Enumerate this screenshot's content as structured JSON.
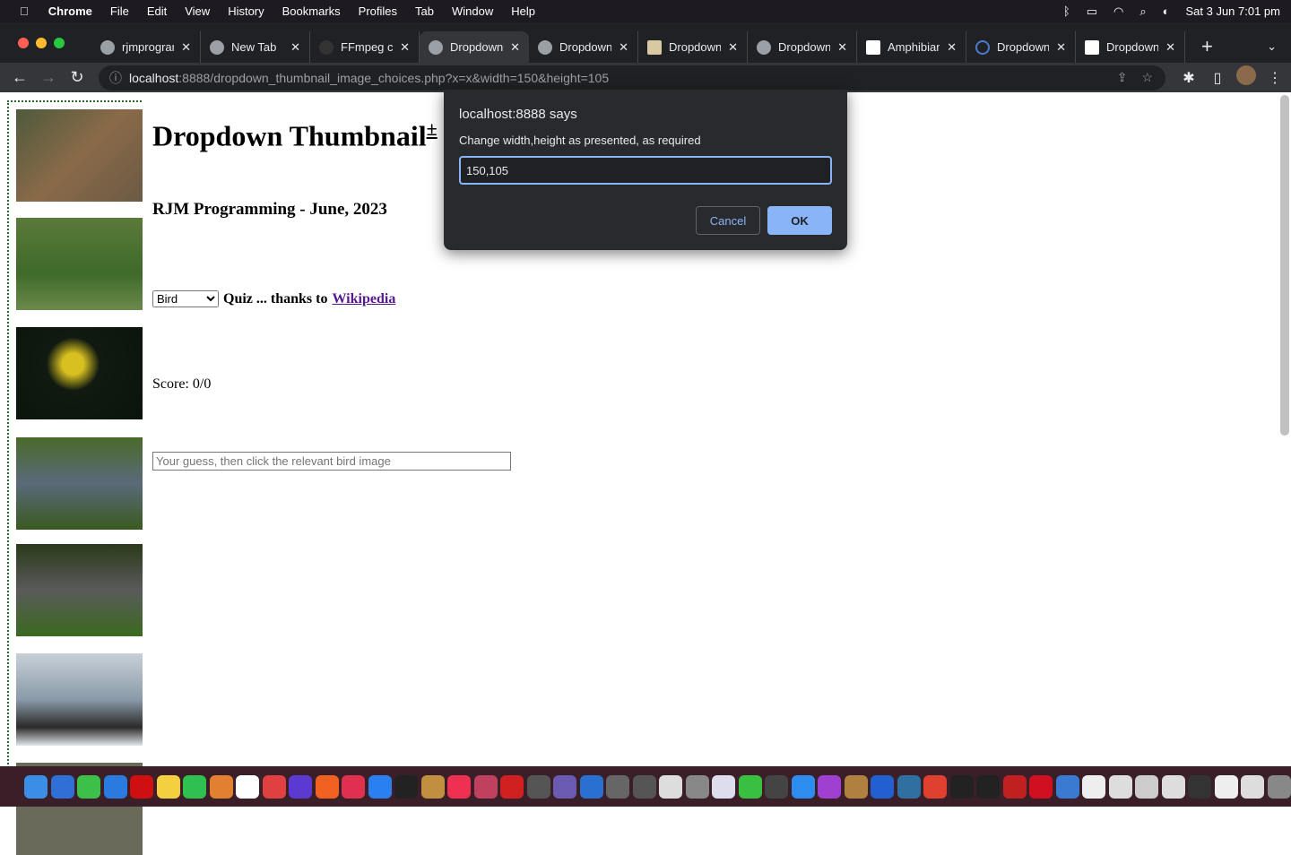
{
  "menubar": {
    "apple": "",
    "app": "Chrome",
    "items": [
      "File",
      "Edit",
      "View",
      "History",
      "Bookmarks",
      "Profiles",
      "Tab",
      "Window",
      "Help"
    ],
    "datetime": "Sat 3 Jun  7:01 pm"
  },
  "tabs": [
    {
      "title": "rjmprogrammin",
      "active": false
    },
    {
      "title": "New Tab",
      "active": false
    },
    {
      "title": "FFmpeg cl",
      "active": false
    },
    {
      "title": "Dropdown",
      "active": true
    },
    {
      "title": "Dropdown",
      "active": false
    },
    {
      "title": "Dropdown",
      "active": false
    },
    {
      "title": "Dropdown",
      "active": false
    },
    {
      "title": "Amphibian",
      "active": false
    },
    {
      "title": "Dropdown",
      "active": false
    },
    {
      "title": "Dropdown",
      "active": false
    }
  ],
  "toolbar": {
    "url_host": "localhost",
    "url_rest": ":8888/dropdown_thumbnail_image_choices.php?x=x&width=150&height=105"
  },
  "page": {
    "title": "Dropdown Thumbnail",
    "title_sup": "±",
    "subtitle": "RJM Programming - June, 2023",
    "select_value": "Bird",
    "quiz_text": "Quiz ... thanks to",
    "link": "Wikipedia",
    "score": "Score: 0/0",
    "guess_placeholder": "Your guess, then click the relevant bird image"
  },
  "thumbnails": [
    "owl",
    "crowned crane",
    "toucan",
    "shoebill",
    "heron",
    "blue-footed booby"
  ],
  "dialog": {
    "title": "localhost:8888 says",
    "message": "Change width,height as presented, as required",
    "value": "150,105",
    "cancel": "Cancel",
    "ok": "OK"
  }
}
